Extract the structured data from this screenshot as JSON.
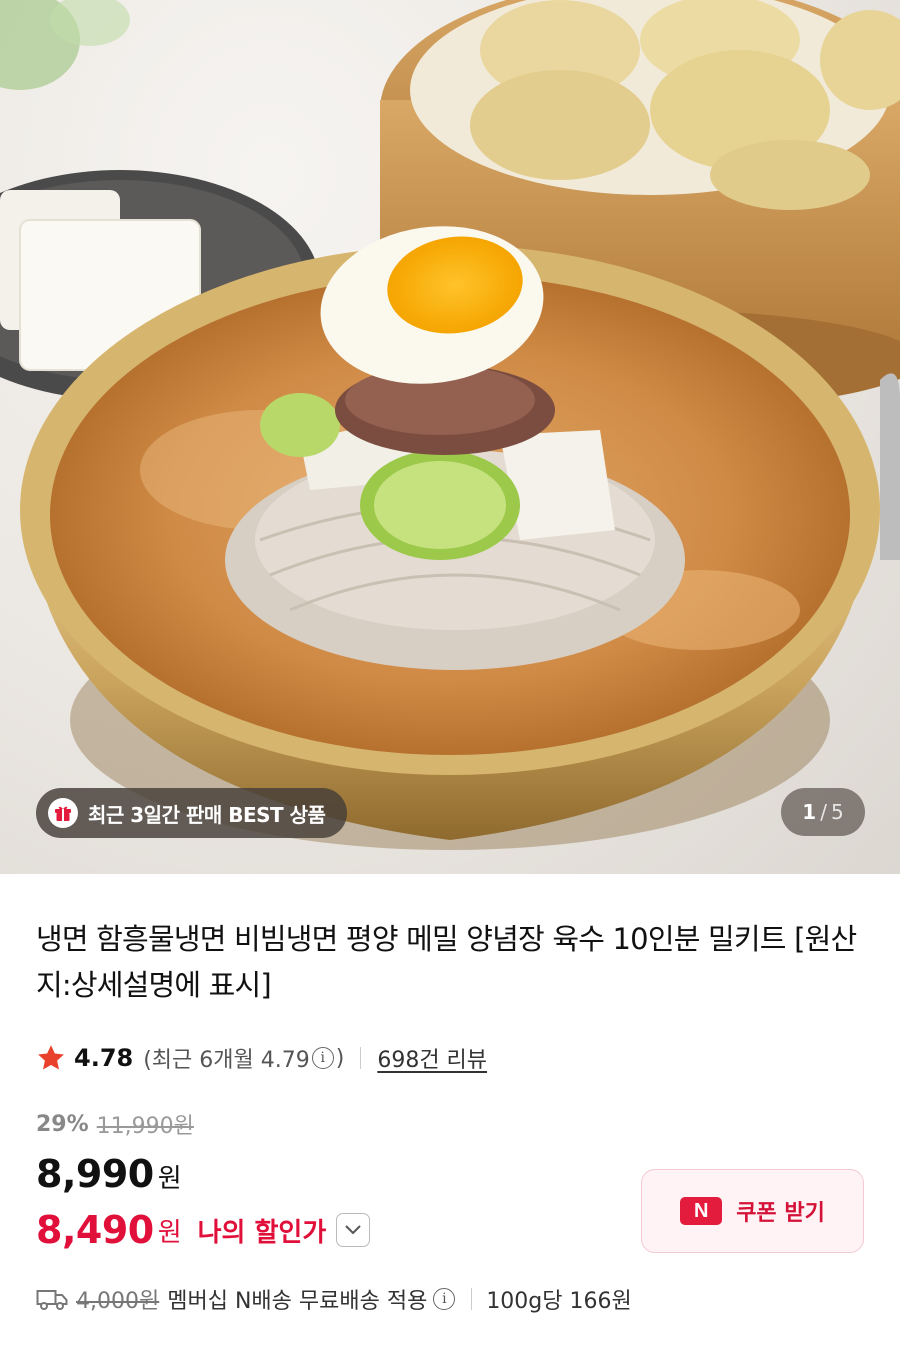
{
  "hero": {
    "badge_label": "최근 3일간 판매 BEST 상품",
    "badge_icon": "gift-icon",
    "pager_current": "1",
    "pager_separator": "/",
    "pager_total": "5"
  },
  "product": {
    "title": "냉면 함흥물냉면 비빔냉면 평양 메밀 양념장 육수 10인분 밀키트 [원산지:상세설명에 표시]"
  },
  "rating": {
    "score": "4.78",
    "recent_prefix": "(최근 6개월 4.79",
    "recent_suffix": ")",
    "reviews": "698건 리뷰",
    "star_color": "#e8412c"
  },
  "price": {
    "discount_rate": "29%",
    "original": "11,990원",
    "sale_amount": "8,990",
    "sale_unit": "원",
    "my_amount": "8,490",
    "my_unit": "원",
    "my_label": "나의 할인가",
    "accent_color": "#e0103a"
  },
  "coupon": {
    "logo": "N",
    "label": "쿠폰 받기"
  },
  "shipping": {
    "fee": "4,000원",
    "text": "멤버십 N배송 무료배송 적용",
    "unit_price": "100g당 166원"
  }
}
